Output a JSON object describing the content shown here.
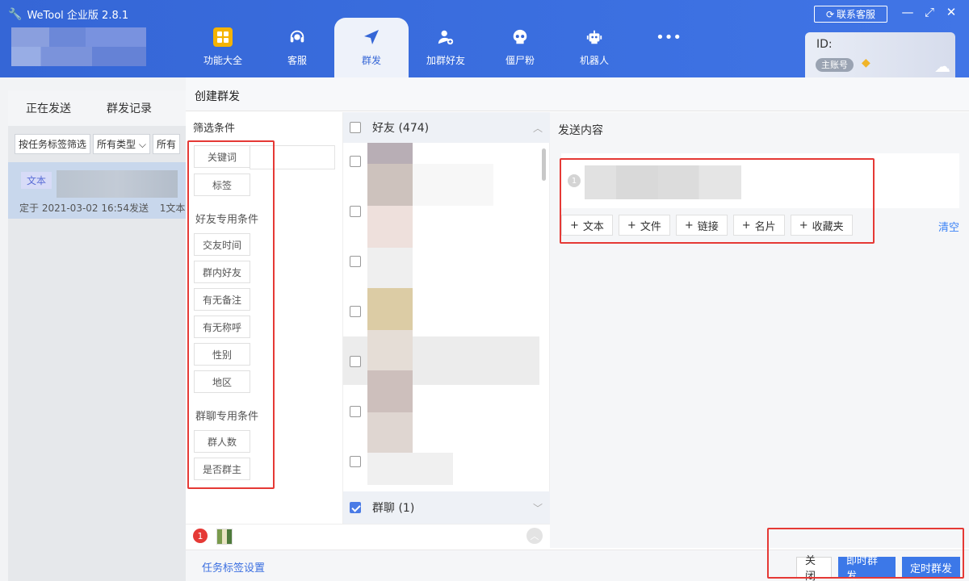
{
  "app": {
    "title": "WeTool 企业版 2.8.1",
    "contact_label": "联系客服",
    "account_id_label": "ID:",
    "account_badge": "主账号"
  },
  "nav": [
    {
      "label": "功能大全",
      "icon": "grid-icon"
    },
    {
      "label": "客服",
      "icon": "headset-icon"
    },
    {
      "label": "群发",
      "icon": "send-icon",
      "active": true
    },
    {
      "label": "加群好友",
      "icon": "add-user-icon"
    },
    {
      "label": "僵尸粉",
      "icon": "skull-icon"
    },
    {
      "label": "机器人",
      "icon": "robot-icon"
    },
    {
      "label": "",
      "icon": "more-icon"
    }
  ],
  "background": {
    "tabs": [
      "正在发送",
      "群发记录"
    ],
    "filters": [
      "按任务标签筛选",
      "所有类型 ⌵",
      "所有"
    ],
    "item": {
      "tag": "文本",
      "meta": "定于 2021-03-02 16:54发送",
      "count": "1文本"
    }
  },
  "dialog": {
    "title": "创建群发",
    "filter": {
      "title": "筛选条件",
      "general": [
        "关键词",
        "标签"
      ],
      "friend_section": "好友专用条件",
      "friend_chips": [
        "交友时间",
        "群内好友",
        "有无备注",
        "有无称呼",
        "性别",
        "地区"
      ],
      "group_section": "群聊专用条件",
      "group_chips": [
        "群人数",
        "是否群主"
      ]
    },
    "list": {
      "friends_label": "好友 (474)",
      "group_label": "群聊 (1)"
    },
    "content": {
      "title": "发送内容",
      "message_index": "1",
      "add_buttons": [
        "文本",
        "文件",
        "链接",
        "名片",
        "收藏夹"
      ],
      "clear_label": "清空"
    },
    "footer": {
      "notif_count": "1",
      "tag_settings": "任务标签设置",
      "close_label": "关闭",
      "send_now_label": "即时群发",
      "schedule_label": "定时群发"
    }
  },
  "colors": {
    "brand_blue": "#3566d6",
    "primary_button": "#3c78e8",
    "highlight_red": "#e53935"
  }
}
